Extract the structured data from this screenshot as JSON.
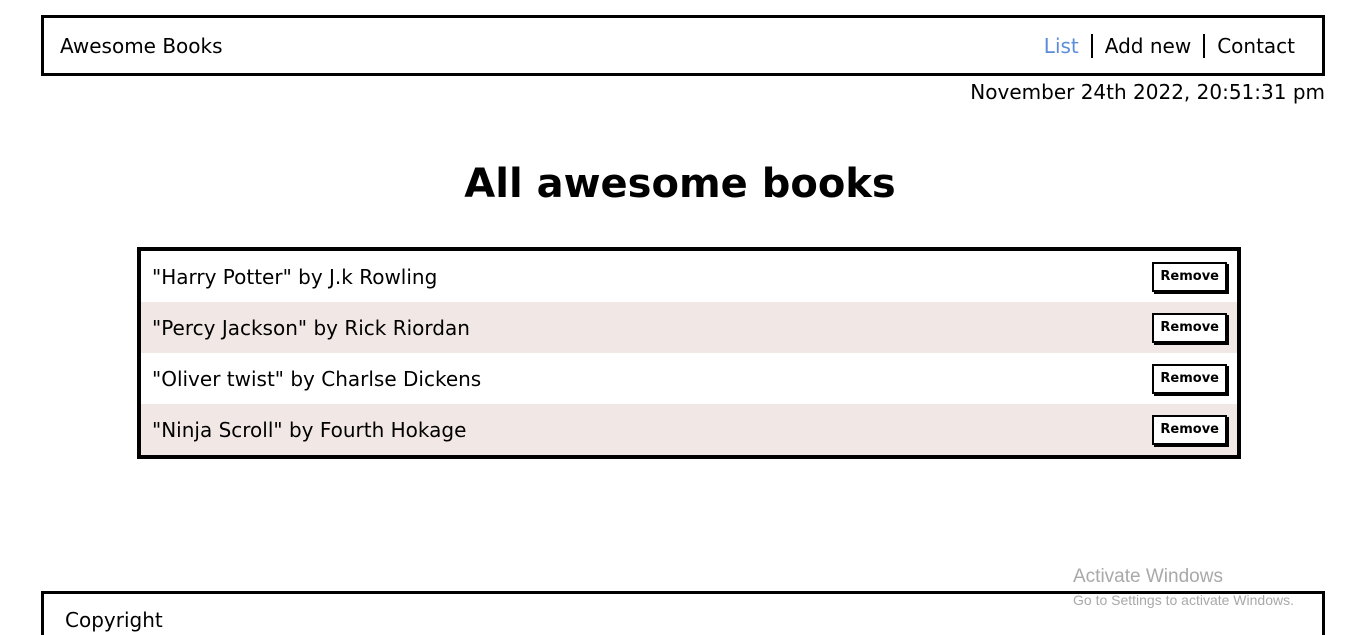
{
  "header": {
    "brand": "Awesome Books",
    "nav": [
      {
        "label": "List",
        "active": true
      },
      {
        "label": "Add new",
        "active": false
      },
      {
        "label": "Contact",
        "active": false
      }
    ]
  },
  "datetime": "November 24th 2022, 20:51:31 pm",
  "main": {
    "title": "All awesome books",
    "books": [
      {
        "text": "\"Harry Potter\" by J.k Rowling",
        "remove_label": "Remove"
      },
      {
        "text": "\"Percy Jackson\" by Rick Riordan",
        "remove_label": "Remove"
      },
      {
        "text": "\"Oliver twist\" by Charlse Dickens",
        "remove_label": "Remove"
      },
      {
        "text": "\"Ninja Scroll\" by Fourth Hokage",
        "remove_label": "Remove"
      }
    ]
  },
  "footer": {
    "text": "Copyright"
  },
  "watermark": {
    "title": "Activate Windows",
    "subtitle": "Go to Settings to activate Windows."
  },
  "colors": {
    "active_link": "#5b8ed8",
    "alt_row": "#f1e8e6"
  }
}
